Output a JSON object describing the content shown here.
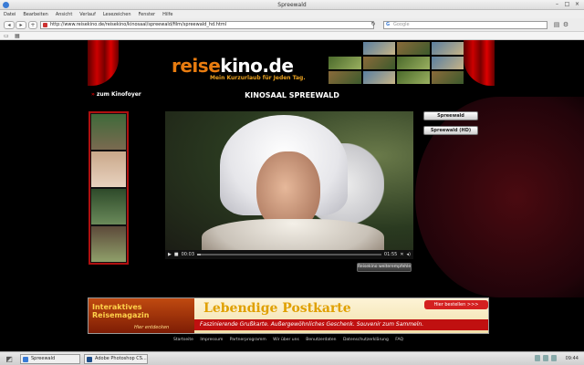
{
  "window": {
    "title": "Spreewald"
  },
  "menu": [
    "Datei",
    "Bearbeiten",
    "Ansicht",
    "Verlauf",
    "Lesezeichen",
    "Fenster",
    "Hilfe"
  ],
  "nav": {
    "url": "http://www.reisekino.de/reisekino/kinosaal/spreewald/film/spreewald_hd.html",
    "search_placeholder": "Google"
  },
  "site": {
    "logo_part1": "reise",
    "logo_part2": "kino.de",
    "slogan": "Mein Kurzurlaub für Jeden Tag.",
    "back_link": "zum Kinofoyer",
    "hall_title": "KINOSAAL SPREEWALD"
  },
  "video": {
    "time_elapsed": "00:03",
    "time_total": "01:55",
    "progress": 0.02
  },
  "buttons": {
    "spreewald": "Spreewald",
    "spreewald_hd": "Spreewald (HD)",
    "recommend": "Reisekino weiterempfehlen!"
  },
  "banner": {
    "left_title": "Interaktives Reisemagazin",
    "left_sub": "Hier entdecken",
    "main_title": "Lebendige Postkarte",
    "strip": "Faszinierende Grußkarte. Außergewöhnliches Geschenk. Souvenir zum Sammeln.",
    "order": "Hier bestellen >>>"
  },
  "footer_links": [
    "Startseite",
    "Impressum",
    "Partnerprogramm",
    "Wir über uns",
    "Benutzerdaten",
    "Datenschutzerklärung",
    "FAQ"
  ],
  "taskbar": {
    "tasks": [
      {
        "label": "Spreewald"
      },
      {
        "label": "Adobe Photoshop CS..."
      }
    ],
    "clock": "09:44"
  }
}
